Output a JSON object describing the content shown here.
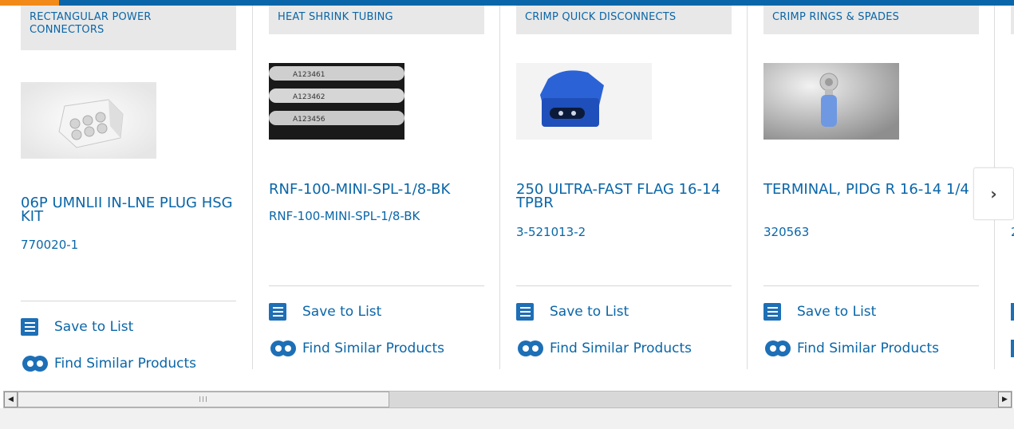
{
  "products": [
    {
      "category": "RECTANGULAR POWER CONNECTORS",
      "title": "06P UMNLII IN-LNE PLUG HSG KIT",
      "part_number": "770020-1",
      "image": "connector-housing-image"
    },
    {
      "category": "HEAT SHRINK TUBING",
      "title": "RNF-100-MINI-SPL-1/8-BK",
      "part_number": "RNF-100-MINI-SPL-1/8-BK",
      "image": "heat-shrink-tubing-image",
      "image_text": [
        "A123461",
        "A123462",
        "A123456"
      ]
    },
    {
      "category": "CRIMP QUICK DISCONNECTS",
      "title": "250 ULTRA-FAST FLAG 16-14 TPBR",
      "part_number": "3-521013-2",
      "image": "quick-disconnect-image"
    },
    {
      "category": "CRIMP RINGS & SPADES",
      "title": "TERMINAL, PIDG R 16-14 1/4",
      "part_number": "320563",
      "image": "ring-terminal-image"
    },
    {
      "part_number_partial": "2"
    }
  ],
  "actions": {
    "save_label": "Save to List",
    "similar_label": "Find Similar Products"
  },
  "nav": {
    "next_icon": "chevron-right-icon",
    "next_glyph": "›"
  },
  "scrollbar": {
    "left_arrow": "◀",
    "right_arrow": "▶",
    "grip": "III"
  },
  "colors": {
    "brand_blue": "#0a66a8",
    "accent_orange": "#f28a1a",
    "category_bg": "#e8e8e8"
  }
}
